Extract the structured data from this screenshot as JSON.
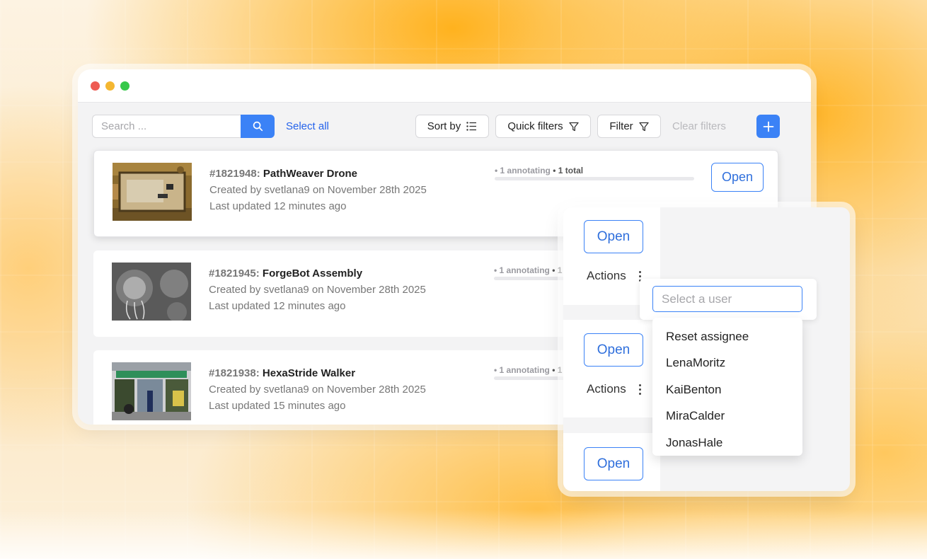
{
  "toolbar": {
    "search_placeholder": "Search ...",
    "select_all": "Select all",
    "sort_by": "Sort by",
    "quick_filters": "Quick filters",
    "filter": "Filter",
    "clear_filters": "Clear filters"
  },
  "tasks": [
    {
      "id": "#1821948:",
      "title": "PathWeaver Drone",
      "created": "Created by svetlana9 on November 28th 2025",
      "updated": "Last updated 12 minutes ago",
      "status": "• 1 annotating",
      "total": "• 1 total",
      "open": "Open"
    },
    {
      "id": "#1821945:",
      "title": "ForgeBot Assembly",
      "created": "Created by svetlana9 on November 28th 2025",
      "updated": "Last updated 12 minutes ago",
      "status": "• 1 annotating",
      "total": "• 1",
      "open": "Open"
    },
    {
      "id": "#1821938:",
      "title": "HexaStride Walker",
      "created": "Created by svetlana9 on November 28th 2025",
      "updated": "Last updated 15 minutes ago",
      "status": "• 1 annotating",
      "total": "• 1",
      "open": "Open"
    }
  ],
  "zoom": {
    "open": "Open",
    "actions": "Actions",
    "user_placeholder": "Select a user",
    "menu": [
      "Reset assignee",
      "LenaMoritz",
      "KaiBenton",
      "MiraCalder",
      "JonasHale"
    ]
  },
  "colors": {
    "accent": "#3b82f6",
    "link": "#2563eb"
  }
}
